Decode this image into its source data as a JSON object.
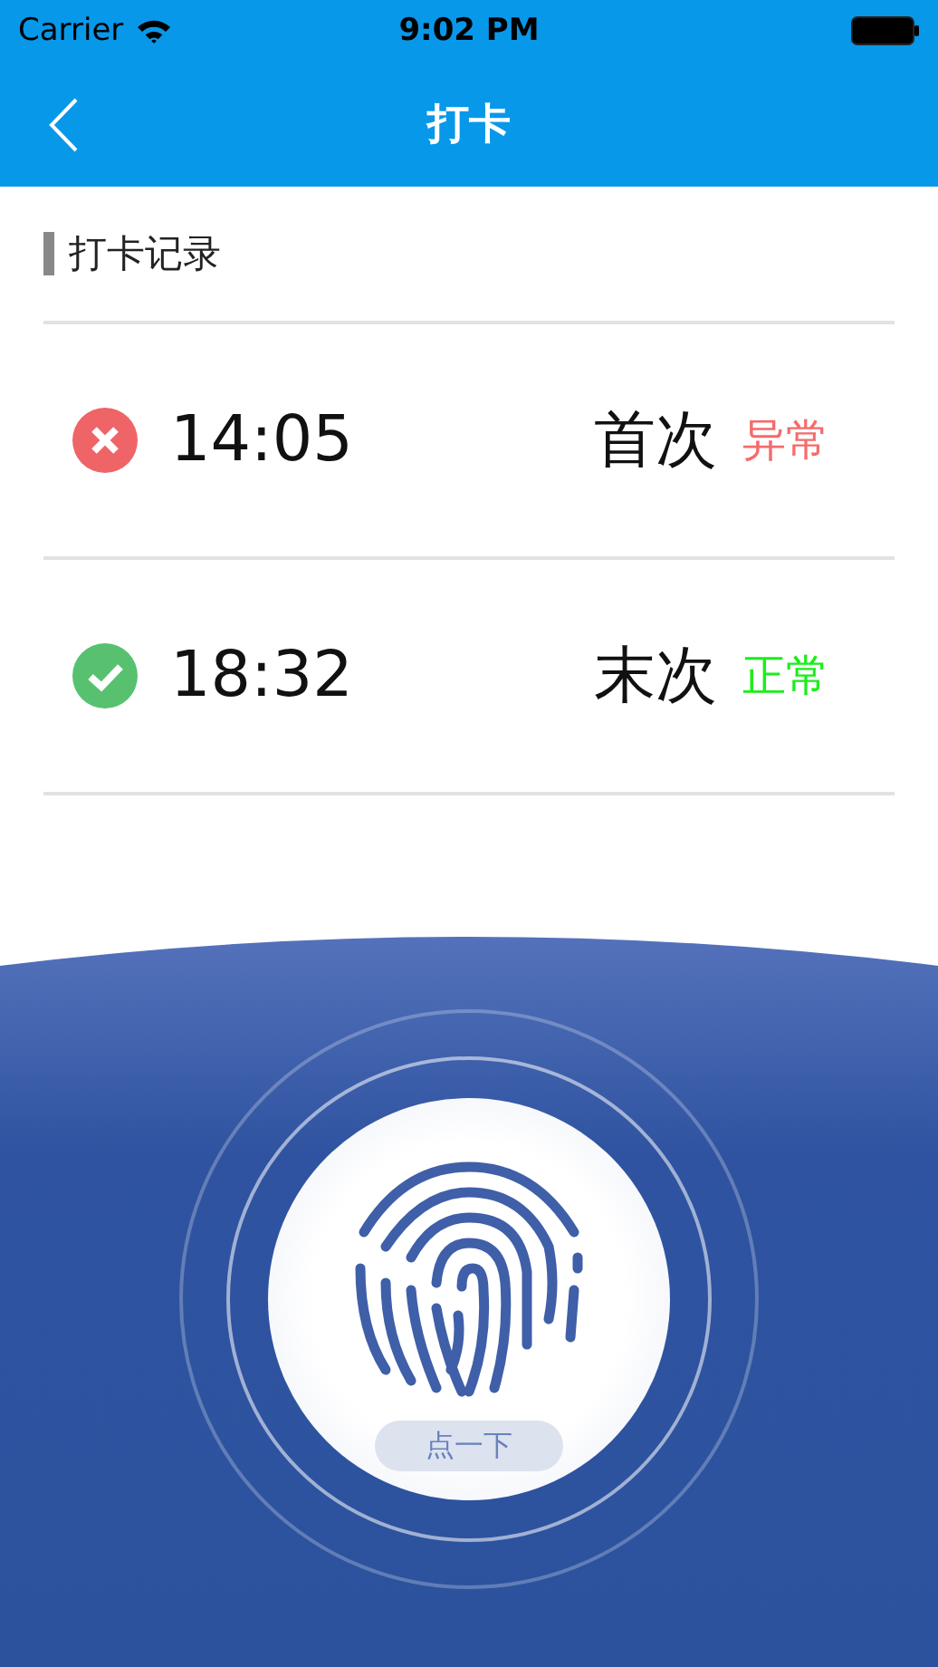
{
  "status_bar": {
    "carrier": "Carrier",
    "time": "9:02 PM"
  },
  "nav": {
    "title": "打卡"
  },
  "section": {
    "title": "打卡记录"
  },
  "records": [
    {
      "kind": "error",
      "time": "14:05",
      "label": "首次",
      "status": "异常",
      "color": "#f56b6b"
    },
    {
      "kind": "ok",
      "time": "18:32",
      "label": "末次",
      "status": "正常",
      "color": "#1aee1a"
    }
  ],
  "punch_button": {
    "label": "点一下"
  }
}
